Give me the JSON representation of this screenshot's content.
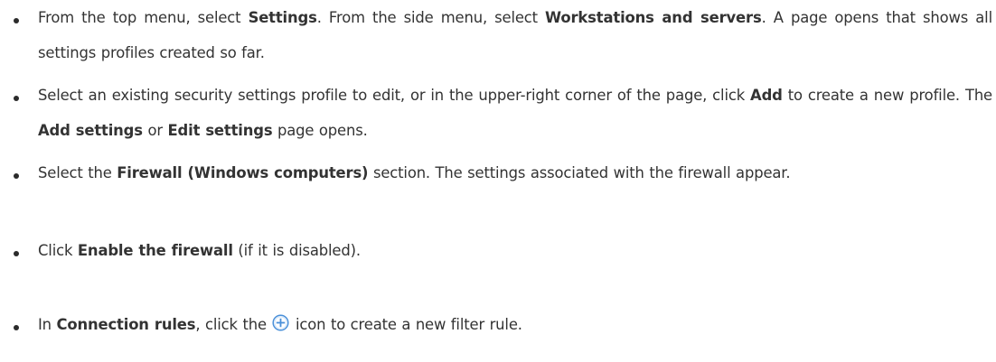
{
  "colors": {
    "text": "#333333",
    "bold_text": "#2a2a2a",
    "bullet": "#2b2b2b",
    "icon_blue": "#4a90d9"
  },
  "steps": [
    {
      "segments": [
        {
          "t": "From the top menu, select ",
          "b": false
        },
        {
          "t": "Settings",
          "b": true
        },
        {
          "t": ". From the side menu, select ",
          "b": false
        },
        {
          "t": "Workstations and servers",
          "b": true
        },
        {
          "t": ". A page opens that shows all settings profiles created so far.",
          "b": false
        }
      ]
    },
    {
      "segments": [
        {
          "t": "Select an existing security settings profile to edit, or in the upper-right corner of the page, click ",
          "b": false
        },
        {
          "t": "Add",
          "b": true
        },
        {
          "t": " to create a new profile. The ",
          "b": false
        },
        {
          "t": "Add settings",
          "b": true
        },
        {
          "t": " or ",
          "b": false
        },
        {
          "t": "Edit settings",
          "b": true
        },
        {
          "t": " page opens.",
          "b": false
        }
      ]
    },
    {
      "segments": [
        {
          "t": "Select the ",
          "b": false
        },
        {
          "t": "Firewall (Windows computers)",
          "b": true
        },
        {
          "t": " section. The settings associated with the firewall appear.",
          "b": false
        }
      ]
    },
    {
      "segments": [
        {
          "t": "Click ",
          "b": false
        },
        {
          "t": "Enable the firewall",
          "b": true
        },
        {
          "t": " (if it is disabled).",
          "b": false
        }
      ]
    },
    {
      "segments": [
        {
          "t": "In ",
          "b": false
        },
        {
          "t": "Connection rules",
          "b": true
        },
        {
          "t": ", click the ",
          "b": false
        },
        {
          "t": "",
          "b": false,
          "icon": "plus-circle-icon"
        },
        {
          "t": " icon to create a new filter rule.",
          "b": false
        }
      ]
    }
  ]
}
